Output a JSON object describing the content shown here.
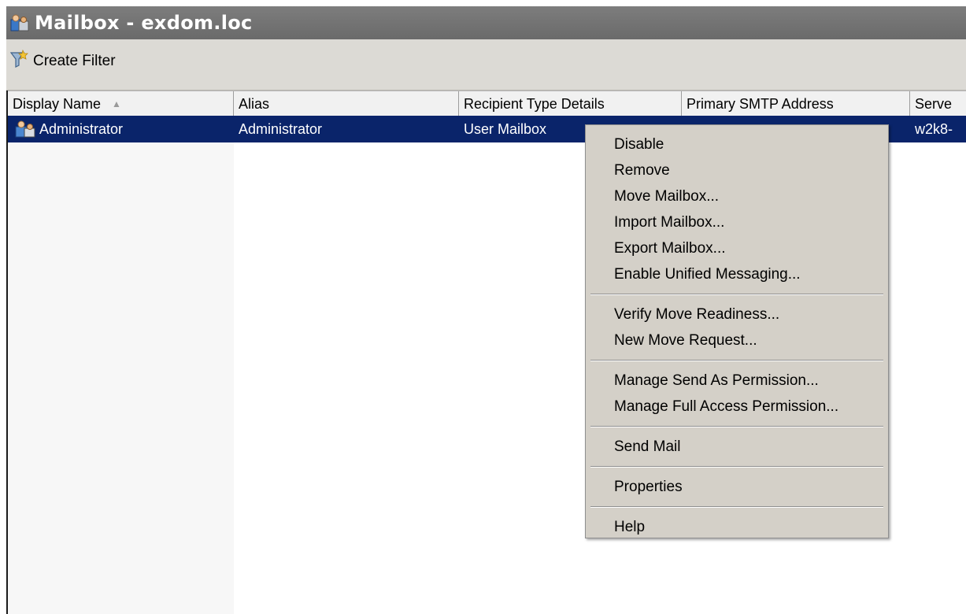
{
  "window": {
    "title": "Mailbox - exdom.loc"
  },
  "toolbar": {
    "create_filter_label": "Create Filter"
  },
  "table": {
    "columns": [
      {
        "label": "Display Name"
      },
      {
        "label": "Alias"
      },
      {
        "label": "Recipient Type Details"
      },
      {
        "label": "Primary SMTP Address"
      },
      {
        "label": "Serve"
      }
    ],
    "rows": [
      {
        "display_name": "Administrator",
        "alias": "Administrator",
        "recipient_type": "User Mailbox",
        "primary_smtp": "",
        "server": "w2k8-"
      }
    ]
  },
  "context_menu": {
    "groups": [
      [
        "Disable",
        "Remove",
        "Move Mailbox...",
        "Import Mailbox...",
        "Export Mailbox...",
        "Enable Unified Messaging..."
      ],
      [
        "Verify Move Readiness...",
        "New Move Request..."
      ],
      [
        "Manage Send As Permission...",
        "Manage Full Access Permission..."
      ],
      [
        "Send Mail"
      ],
      [
        "Properties"
      ],
      [
        "Help"
      ]
    ]
  },
  "colors": {
    "selection": "#0a246a",
    "menu_bg": "#d4d0c8",
    "title_bar": "#707070"
  },
  "icons": {
    "title": "mailbox-users-icon",
    "filter": "filter-funnel-icon",
    "row": "user-mailbox-icon"
  }
}
